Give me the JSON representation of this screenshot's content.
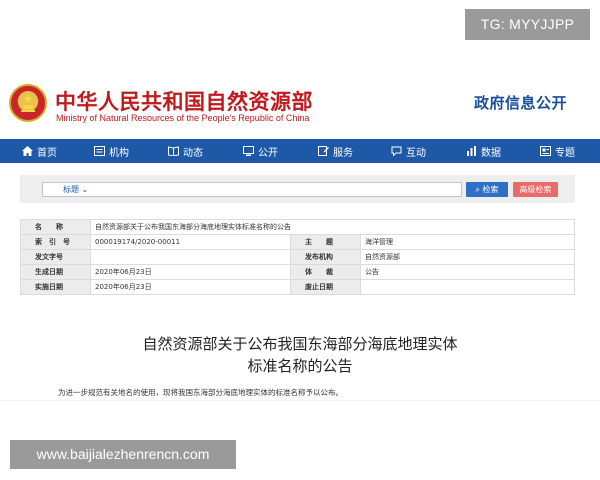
{
  "watermark_top": "TG: MYYJJPP",
  "watermark_bottom": "www.baijialezhenrencn.com",
  "header": {
    "title": "中华人民共和国自然资源部",
    "subtitle": "Ministry of Natural Resources of the People's Republic of China",
    "gov_info": "政府信息公开"
  },
  "nav": {
    "items": [
      {
        "label": "首页",
        "icon": "home-icon"
      },
      {
        "label": "机构",
        "icon": "org-icon"
      },
      {
        "label": "动态",
        "icon": "news-icon"
      },
      {
        "label": "公开",
        "icon": "monitor-icon"
      },
      {
        "label": "服务",
        "icon": "edit-icon"
      },
      {
        "label": "互动",
        "icon": "chat-icon"
      },
      {
        "label": "数据",
        "icon": "chart-icon"
      },
      {
        "label": "专题",
        "icon": "topic-icon"
      }
    ]
  },
  "search": {
    "select_label": "标题",
    "search_button": "检索",
    "advanced_button": "高级检索"
  },
  "meta": {
    "name_label": "名　　称",
    "name_value": "自然资源部关于公布我国东海部分海底地理实体标准名称的公告",
    "index_label": "索　引　号",
    "index_value": "000019174/2020-00011",
    "theme_label": "主　　题",
    "theme_value": "海洋管理",
    "doc_no_label": "发文字号",
    "doc_no_value": "",
    "issuer_label": "发布机构",
    "issuer_value": "自然资源部",
    "created_label": "生成日期",
    "created_value": "2020年06月23日",
    "genre_label": "体　　裁",
    "genre_value": "公告",
    "effective_label": "实施日期",
    "effective_value": "2020年06月23日",
    "abolish_label": "废止日期",
    "abolish_value": ""
  },
  "article": {
    "title_line1": "自然资源部关于公布我国东海部分海底地理实体",
    "title_line2": "标准名称的公告",
    "body": "为进一步规范有关地名的使用，现将我国东海部分海底地理实体的标准名称予以公布。"
  },
  "colors": {
    "brand_red": "#c0191e",
    "nav_blue": "#1e59a8",
    "search_blue": "#2f6fc6",
    "advanced_red": "#e96a6a"
  }
}
